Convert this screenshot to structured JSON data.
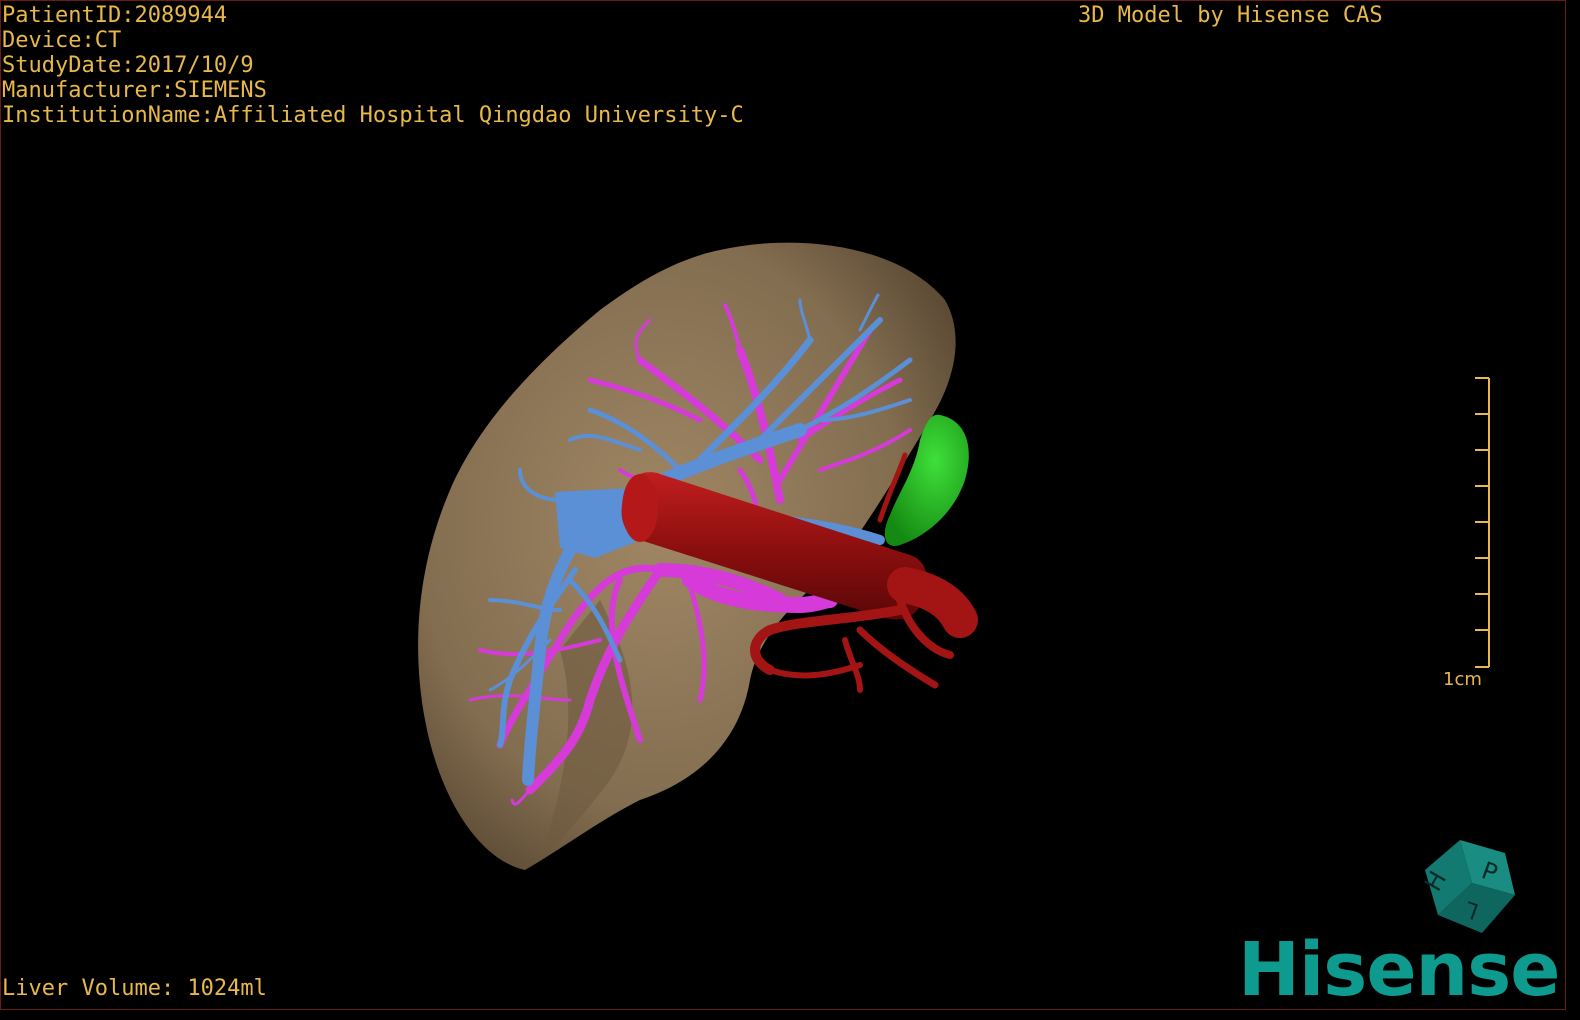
{
  "overlay": {
    "patient_id": "PatientID:2089944",
    "device": "Device:CT",
    "study_date": "StudyDate:2017/10/9",
    "manufacturer": "Manufacturer:SIEMENS",
    "institution": "InstitutionName:Affiliated Hospital Qingdao University-C",
    "model_credit": "3D Model by Hisense CAS",
    "liver_volume": "Liver Volume: 1024ml"
  },
  "scale_bar": {
    "label": "1cm"
  },
  "orientation_cube": {
    "faces": [
      "H",
      "P",
      "L"
    ]
  },
  "logo": {
    "text": "Hisense"
  },
  "colors": {
    "overlay_text": "#e8b84a",
    "liver": "#9c8462",
    "portal_vein": "#5b8fd6",
    "hepatic_vein": "#d63ad8",
    "artery": "#a31414",
    "gallbladder": "#22b41e",
    "logo": "#0e9a8e",
    "cube": "#137a72"
  }
}
